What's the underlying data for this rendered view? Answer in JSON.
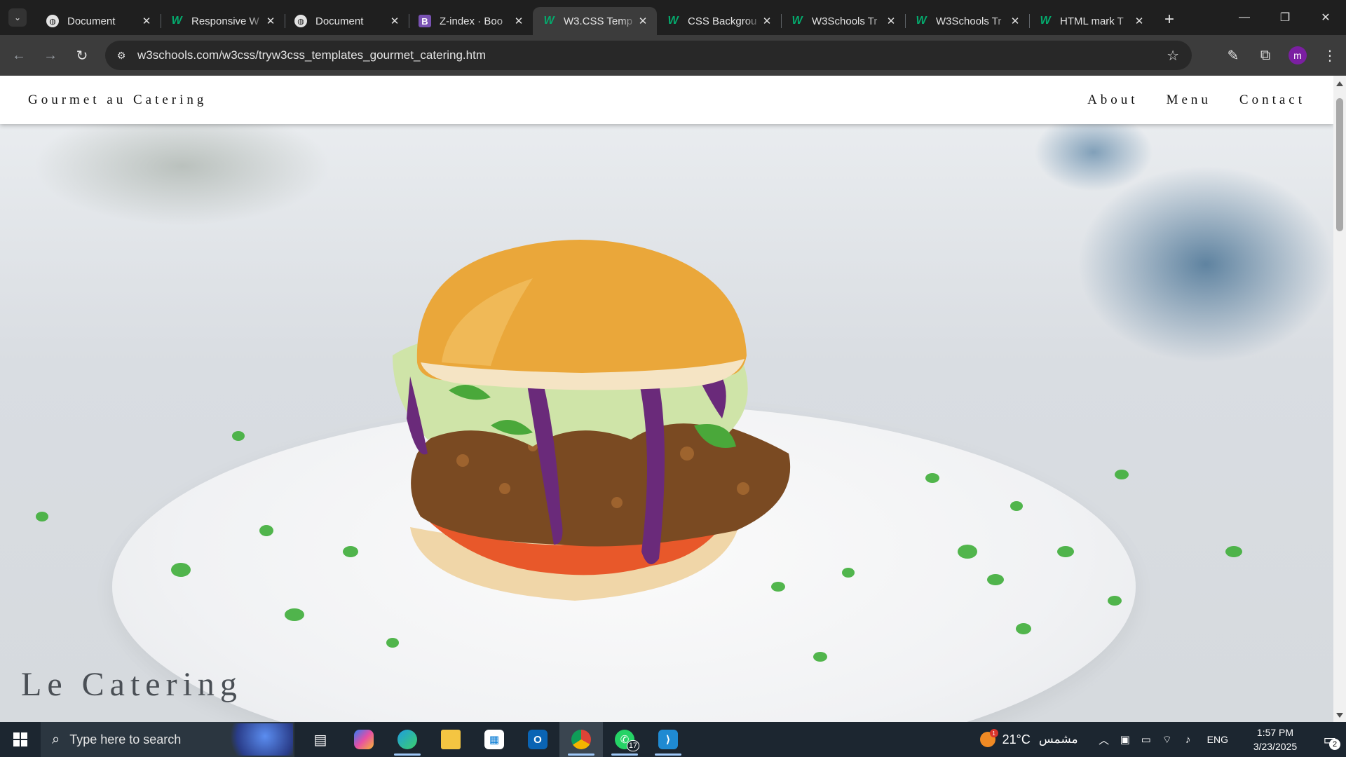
{
  "browser": {
    "tabs": [
      {
        "title": "Document",
        "favicon": "globe-icon"
      },
      {
        "title": "Responsive W",
        "favicon": "w3schools-icon"
      },
      {
        "title": "Document",
        "favicon": "globe-icon"
      },
      {
        "title": "Z-index · Boo",
        "favicon": "bootstrap-icon"
      },
      {
        "title": "W3.CSS Temp",
        "favicon": "w3schools-icon",
        "active": true
      },
      {
        "title": "CSS Backgrou",
        "favicon": "w3schools-icon"
      },
      {
        "title": "W3Schools Tr",
        "favicon": "w3schools-icon"
      },
      {
        "title": "W3Schools Tr",
        "favicon": "w3schools-icon"
      },
      {
        "title": "HTML mark T",
        "favicon": "w3schools-icon"
      }
    ],
    "url": "w3schools.com/w3css/tryw3css_templates_gourmet_catering.htm",
    "profile_initial": "m"
  },
  "site": {
    "brand": "Gourmet au Catering",
    "nav": [
      "About",
      "Menu",
      "Contact"
    ],
    "hero_title": "Le Catering"
  },
  "taskbar": {
    "search_placeholder": "Type here to search",
    "whatsapp_badge": "17",
    "weather_badge": "1",
    "temperature": "21°C",
    "condition": "مشمس",
    "language": "ENG",
    "time": "1:57 PM",
    "date": "3/23/2025",
    "notification_count": "2"
  },
  "colors": {
    "chrome_bg": "#1f1f1f",
    "toolbar_bg": "#3c3c3c",
    "taskbar_bg": "#1c2630",
    "w3_green": "#04aa6d"
  }
}
